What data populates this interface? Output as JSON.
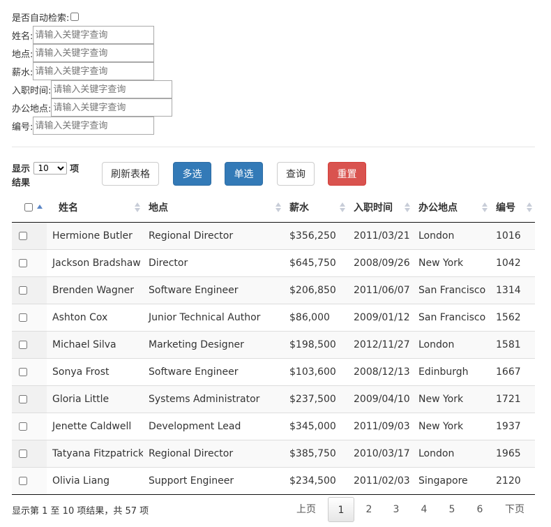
{
  "filters": {
    "auto_search_label": "是否自动检索:",
    "fields": [
      {
        "label": "姓名:",
        "placeholder": "请输入关键字查询"
      },
      {
        "label": "地点:",
        "placeholder": "请输入关键字查询"
      },
      {
        "label": "薪水:",
        "placeholder": "请输入关键字查询"
      },
      {
        "label": "入职时间:",
        "placeholder": "请输入关键字查询"
      },
      {
        "label": "办公地点:",
        "placeholder": "请输入关键字查询"
      },
      {
        "label": "编号:",
        "placeholder": "请输入关键字查询"
      }
    ]
  },
  "toolbar": {
    "length_prefix": "显示",
    "length_value": "10",
    "length_suffix": "项",
    "length_suffix2": "结果",
    "refresh_label": "刷新表格",
    "multi_label": "多选",
    "single_label": "单选",
    "query_label": "查询",
    "reset_label": "重置"
  },
  "colors": {
    "primary": "#337ab7",
    "danger": "#d9534f",
    "sort_active": "#5b86c5"
  },
  "table": {
    "columns": [
      "姓名",
      "地点",
      "薪水",
      "入职时间",
      "办公地点",
      "编号"
    ],
    "rows": [
      [
        "Hermione Butler",
        "Regional Director",
        "$356,250",
        "2011/03/21",
        "London",
        "1016"
      ],
      [
        "Jackson Bradshaw",
        "Director",
        "$645,750",
        "2008/09/26",
        "New York",
        "1042"
      ],
      [
        "Brenden Wagner",
        "Software Engineer",
        "$206,850",
        "2011/06/07",
        "San Francisco",
        "1314"
      ],
      [
        "Ashton Cox",
        "Junior Technical Author",
        "$86,000",
        "2009/01/12",
        "San Francisco",
        "1562"
      ],
      [
        "Michael Silva",
        "Marketing Designer",
        "$198,500",
        "2012/11/27",
        "London",
        "1581"
      ],
      [
        "Sonya Frost",
        "Software Engineer",
        "$103,600",
        "2008/12/13",
        "Edinburgh",
        "1667"
      ],
      [
        "Gloria Little",
        "Systems Administrator",
        "$237,500",
        "2009/04/10",
        "New York",
        "1721"
      ],
      [
        "Jenette Caldwell",
        "Development Lead",
        "$345,000",
        "2011/09/03",
        "New York",
        "1937"
      ],
      [
        "Tatyana Fitzpatrick",
        "Regional Director",
        "$385,750",
        "2010/03/17",
        "London",
        "1965"
      ],
      [
        "Olivia Liang",
        "Support Engineer",
        "$234,500",
        "2011/02/03",
        "Singapore",
        "2120"
      ]
    ]
  },
  "footer": {
    "info": "显示第 1 至 10 项结果，共 57 项",
    "prev": "上页",
    "pages": [
      "1",
      "2",
      "3",
      "4",
      "5",
      "6"
    ],
    "current_page": "1",
    "next": "下页"
  }
}
